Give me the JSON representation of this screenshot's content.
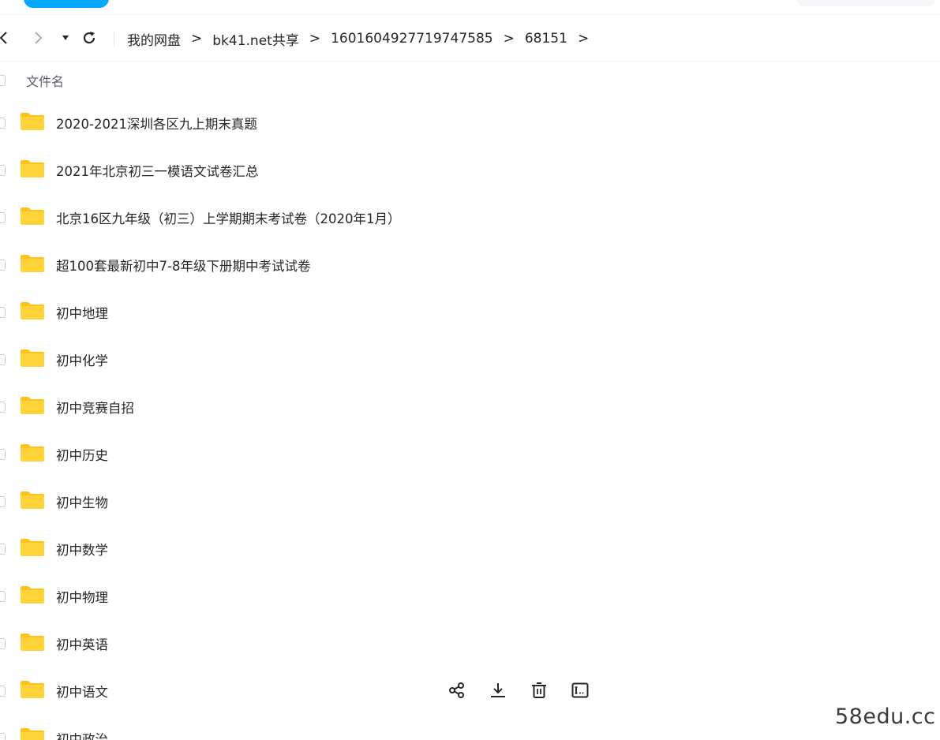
{
  "nav": {
    "breadcrumb": [
      {
        "label": "我的网盘"
      },
      {
        "label": "bk41.net共享"
      },
      {
        "label": "1601604927719747585"
      },
      {
        "label": "68151"
      }
    ],
    "separator": ">",
    "icons": [
      "back-icon",
      "forward-icon",
      "dropdown-icon",
      "refresh-icon"
    ]
  },
  "list": {
    "header_label": "文件名",
    "items": [
      {
        "name": "2020-2021深圳各区九上期末真题"
      },
      {
        "name": "2021年北京初三一模语文试卷汇总"
      },
      {
        "name": "北京16区九年级（初三）上学期期末考试卷（2020年1月）"
      },
      {
        "name": "超100套最新初中7-8年级下册期中考试试卷"
      },
      {
        "name": "初中地理"
      },
      {
        "name": "初中化学"
      },
      {
        "name": "初中竞赛自招"
      },
      {
        "name": "初中历史"
      },
      {
        "name": "初中生物"
      },
      {
        "name": "初中数学"
      },
      {
        "name": "初中物理"
      },
      {
        "name": "初中英语"
      },
      {
        "name": "初中语文"
      },
      {
        "name": "初中政治"
      }
    ],
    "row_actions": [
      "share-icon",
      "download-icon",
      "delete-icon",
      "rename-icon"
    ]
  },
  "watermark": "58edu.cc",
  "colors": {
    "accent": "#06a7ff",
    "folder": "#ffd43b",
    "folder_tab": "#ffc21a",
    "text": "#25262b"
  }
}
